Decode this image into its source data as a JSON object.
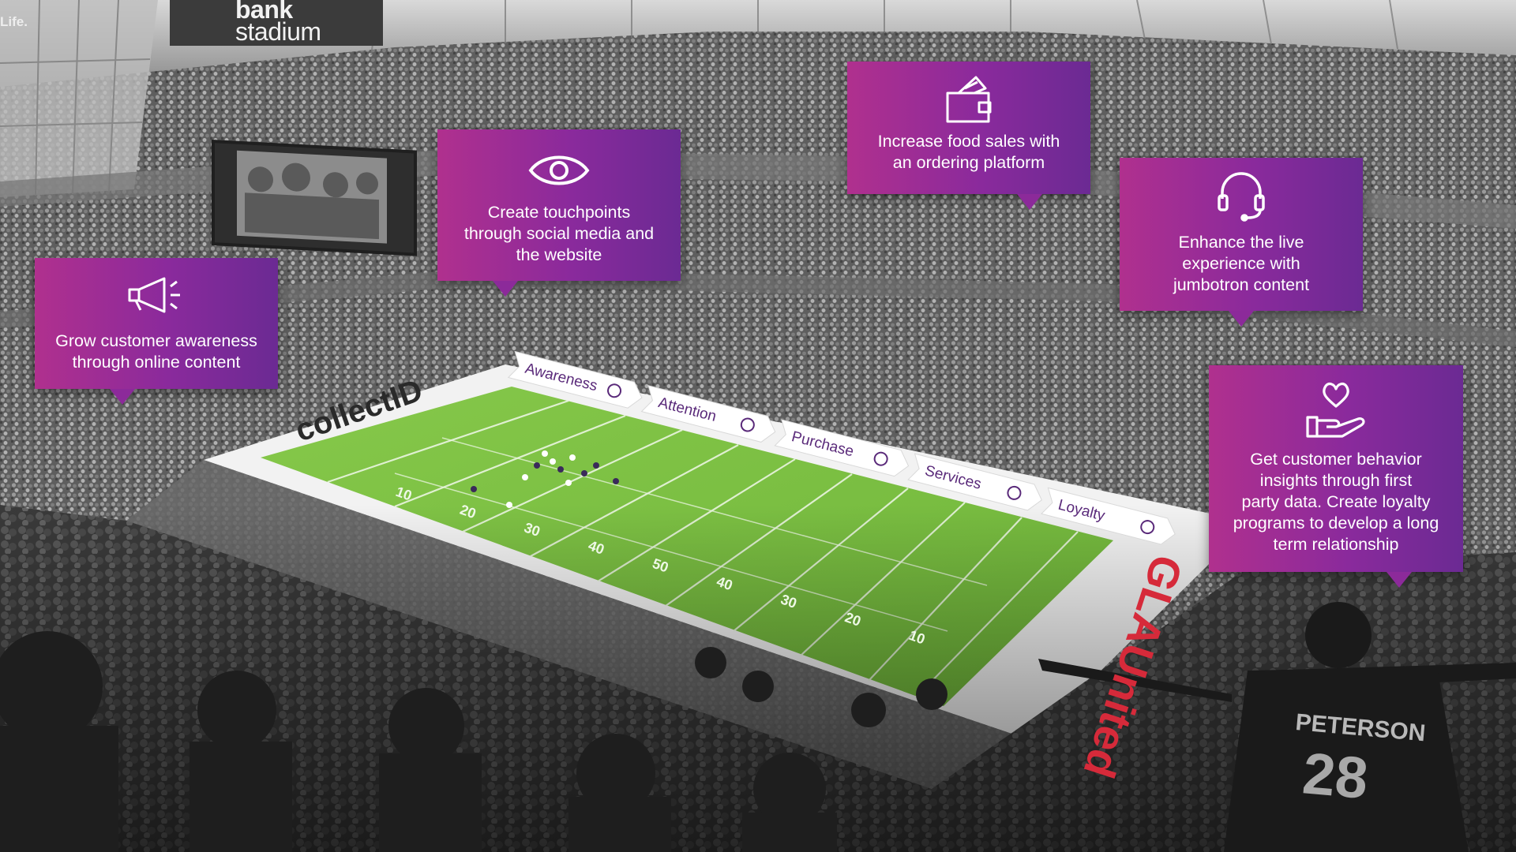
{
  "stadium_sign": {
    "top": "bank",
    "bottom": "stadium"
  },
  "corner_sign": "Life.",
  "field_logo_left": "collectID",
  "field_logo_right": "GLAUnited",
  "jersey": {
    "name": "PETERSON",
    "number": "28"
  },
  "callouts": [
    {
      "id": "awareness",
      "icon": "megaphone-icon",
      "text_lines": [
        "Grow customer awareness",
        "through online content"
      ]
    },
    {
      "id": "attention",
      "icon": "eye-icon",
      "text_lines": [
        "Create touchpoints",
        "through social media and",
        "the website"
      ]
    },
    {
      "id": "purchase",
      "icon": "wallet-icon",
      "text_lines": [
        "Increase food sales with",
        "an ordering platform"
      ]
    },
    {
      "id": "services",
      "icon": "headset-icon",
      "text_lines": [
        "Enhance the live",
        "experience with",
        "jumbotron content"
      ]
    },
    {
      "id": "loyalty",
      "icon": "heart-hand-icon",
      "text_lines": [
        "Get customer behavior",
        "insights through first",
        "party data. Create loyalty",
        "programs to develop a long",
        "term relationship"
      ]
    }
  ],
  "journey_steps": [
    {
      "label": "Awareness",
      "icon": "megaphone-icon"
    },
    {
      "label": "Attention",
      "icon": "eye-icon"
    },
    {
      "label": "Purchase",
      "icon": "wallet-icon"
    },
    {
      "label": "Services",
      "icon": "headset-icon"
    },
    {
      "label": "Loyalty",
      "icon": "heart-hand-icon"
    }
  ],
  "yard_numbers": [
    "10",
    "20",
    "30",
    "40",
    "50",
    "40",
    "30",
    "20",
    "10"
  ],
  "colors": {
    "accent_magenta": "#b0308e",
    "accent_purple": "#6b2a93",
    "turf": "#7bc142",
    "field_logo_purple": "#7a2e8f",
    "field_logo_red": "#d62a3a"
  }
}
